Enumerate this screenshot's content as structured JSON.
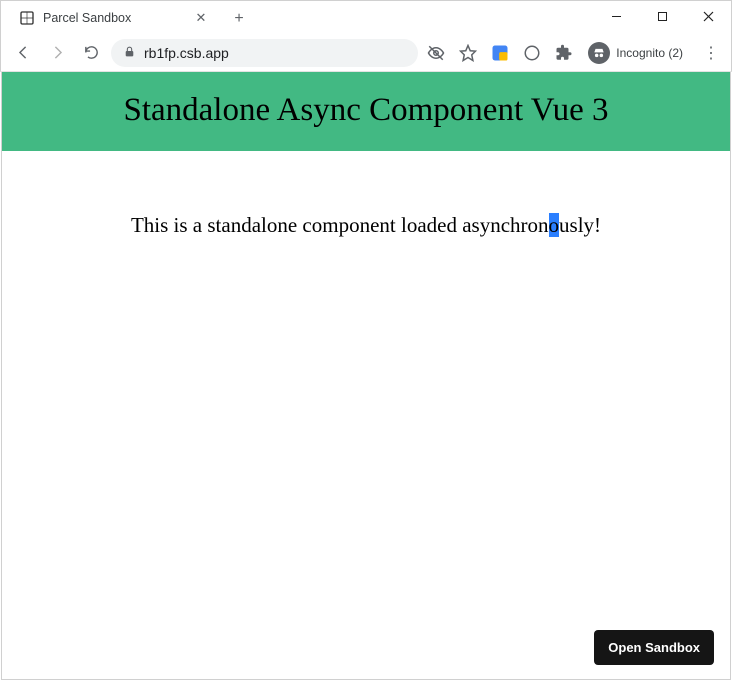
{
  "window": {
    "controls": {
      "min": "–",
      "max": "▢",
      "close": "✕"
    }
  },
  "tab": {
    "title": "Parcel Sandbox",
    "close_glyph": "✕",
    "newtab_glyph": "+"
  },
  "nav": {
    "back": "←",
    "forward": "→",
    "reload": "⟳"
  },
  "omnibox": {
    "lock_glyph": "🔒",
    "url": "rb1fp.csb.app"
  },
  "toolbar_icons": {
    "eye": "eye-off-icon",
    "star": "star-icon",
    "ext1": "extension-icon",
    "notify": "notification-icon",
    "puzzle": "extensions-puzzle-icon",
    "incognito_label": "Incognito (2)",
    "menu": "⋮"
  },
  "page": {
    "heading": "Standalone Async Component Vue 3",
    "body_pre": "This is a standalone component loaded asynchron",
    "body_sel": "o",
    "body_post": "usly!"
  },
  "sandbox_button": "Open Sandbox"
}
